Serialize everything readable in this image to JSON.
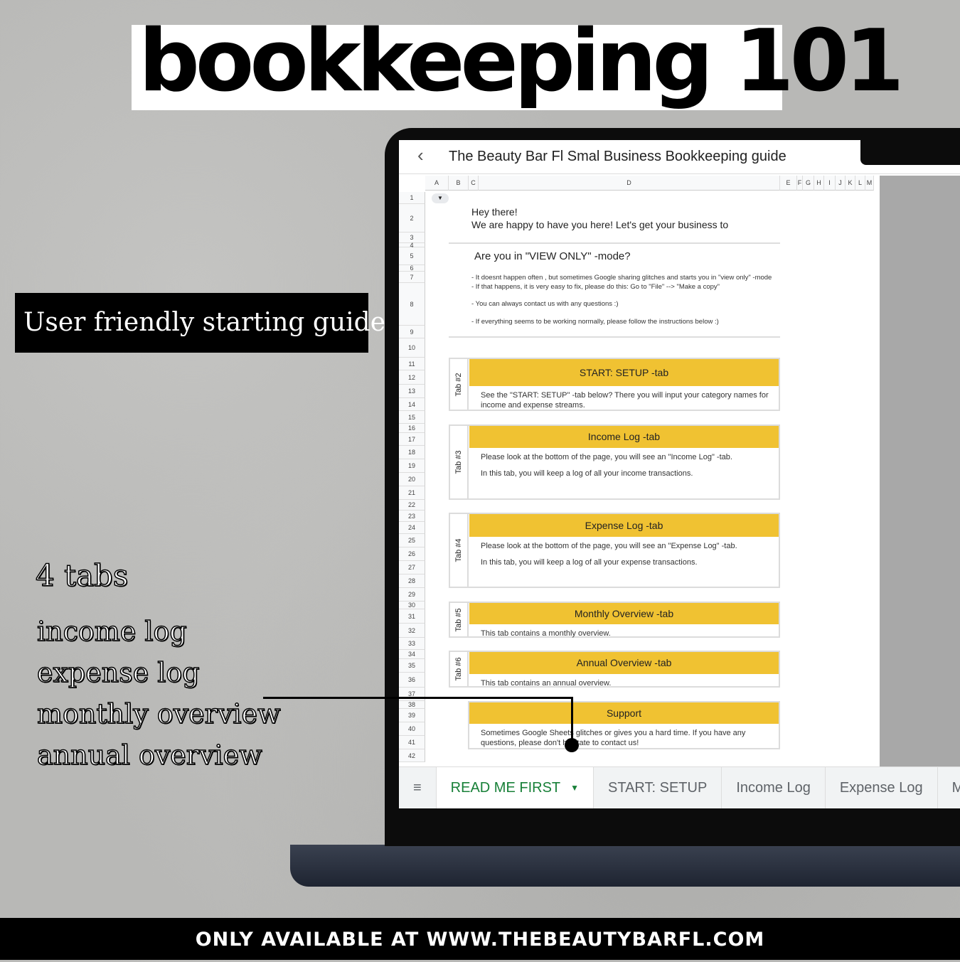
{
  "headline": "bookkeeping 101",
  "guide_label": "User friendly starting guide",
  "features": {
    "count": "4 tabs",
    "items": [
      "income log",
      "expense log",
      "monthly overview",
      "annual overview"
    ]
  },
  "footer": "ONLY AVAILABLE AT WWW.THEBEAUTYBARFL.COM",
  "sheet": {
    "title": "The Beauty Bar Fl Smal Business Bookkeeping guide",
    "columns": [
      "A",
      "B",
      "C",
      "D",
      "E",
      "F",
      "G",
      "H",
      "I",
      "J",
      "K",
      "L",
      "M"
    ],
    "rows": [
      "1",
      "2",
      "3",
      "4",
      "5",
      "6",
      "7",
      "8",
      "9",
      "10",
      "11",
      "12",
      "13",
      "14",
      "15",
      "16",
      "17",
      "18",
      "19",
      "20",
      "21",
      "22",
      "23",
      "24",
      "25",
      "26",
      "27",
      "28",
      "29",
      "30",
      "31",
      "32",
      "33",
      "34",
      "35",
      "36",
      "37",
      "38",
      "39",
      "40",
      "41",
      "42"
    ],
    "greeting": "Hey there!",
    "welcome": "We are happy to have you here! Let's get your business to",
    "view_only_heading": "Are you in \"VIEW ONLY\" -mode?",
    "notes": [
      "-  It doesnt happen often , but sometimes Google sharing glitches and starts you in \"view only\" -mode",
      "- If that happens, it is very easy to fix, please do this: Go to \"File\" --> \"Make a copy\"",
      "- You can always contact us with any questions :)",
      "- If everything seems to be working normally, please follow the instructions below :)"
    ],
    "cards": [
      {
        "tab": "Tab #2",
        "title": "START: SETUP -tab",
        "body": [
          "See the \"START: SETUP\" -tab below? There you will input your category names for income and expense streams."
        ]
      },
      {
        "tab": "Tab #3",
        "title": "Income Log -tab",
        "body": [
          "Please look at the bottom of the page, you will see an \"Income Log\" -tab.",
          "In this tab, you will keep a log of all your income transactions."
        ]
      },
      {
        "tab": "Tab #4",
        "title": "Expense Log -tab",
        "body": [
          "Please look at the bottom of the page, you will see an \"Expense Log\" -tab.",
          "In this tab, you will keep a log of all your expense transactions."
        ]
      },
      {
        "tab": "Tab #5",
        "title": "Monthly Overview -tab",
        "body": [
          "This tab contains a monthly overview."
        ]
      },
      {
        "tab": "Tab #6",
        "title": "Annual Overview -tab",
        "body": [
          "This tab contains an annual overview."
        ]
      },
      {
        "tab": "",
        "title": "Support",
        "body": [
          "Sometimes Google Sheets glitches or gives you a hard time. If you have any questions, please don't hesitate to contact us!"
        ]
      }
    ],
    "tabs": [
      "READ ME FIRST",
      "START: SETUP",
      "Income Log",
      "Expense Log",
      "M"
    ],
    "active_tab": "READ ME FIRST",
    "accent": "#f0c232",
    "active_tab_color": "#188038"
  }
}
